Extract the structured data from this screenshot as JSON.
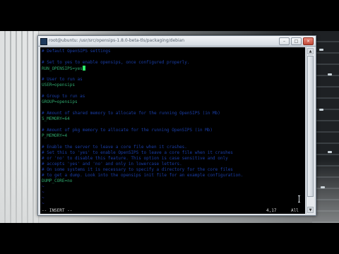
{
  "window": {
    "title": "root@ubuntu: /usr/src/opensips-1.8.0-beta-tls/packaging/debian",
    "minimize_glyph": "–",
    "maximize_glyph": "□",
    "close_glyph": "×"
  },
  "editor": {
    "lines": [
      {
        "text": "# Default OpenSIPS settings",
        "style": "comment"
      },
      {
        "text": "",
        "style": "setting"
      },
      {
        "text": "# Set to yes to enable opensips, once configured properly.",
        "style": "comment"
      },
      {
        "text": "RUN_OPENSIPS=yes",
        "style": "setting",
        "cursor": true
      },
      {
        "text": "",
        "style": "setting"
      },
      {
        "text": "# User to run as",
        "style": "comment"
      },
      {
        "text": "USER=opensips",
        "style": "setting"
      },
      {
        "text": "",
        "style": "setting"
      },
      {
        "text": "# Group to run as",
        "style": "comment"
      },
      {
        "text": "GROUP=opensips",
        "style": "setting"
      },
      {
        "text": "",
        "style": "setting"
      },
      {
        "text": "# Amount of shared memory to allocate for the running OpenSIPS (in Mb)",
        "style": "comment"
      },
      {
        "text": "S_MEMORY=64",
        "style": "setting"
      },
      {
        "text": "",
        "style": "setting"
      },
      {
        "text": "# Amount of pkg memory to allocate for the running OpenSIPS (in Mb)",
        "style": "comment"
      },
      {
        "text": "P_MEMORY=4",
        "style": "setting"
      },
      {
        "text": "",
        "style": "setting"
      },
      {
        "text": "# Enable the server to leave a core file when it crashes.",
        "style": "comment"
      },
      {
        "text": "# Set this to 'yes' to enable OpenSIPS to leave a core file when it crashes",
        "style": "comment"
      },
      {
        "text": "# or 'no' to disable this feature. This option is case sensitive and only",
        "style": "comment"
      },
      {
        "text": "# accepts 'yes' and 'no' and only in lowercase letters.",
        "style": "comment"
      },
      {
        "text": "# On some systems it is necessary to specify a directory for the core files",
        "style": "comment"
      },
      {
        "text": "# to get a dump. Look into the opensips init file for an example configuration.",
        "style": "comment"
      },
      {
        "text": "DUMP_CORE=no",
        "style": "setting"
      },
      {
        "text": "~",
        "style": "tilde"
      },
      {
        "text": "~",
        "style": "tilde"
      },
      {
        "text": "~",
        "style": "tilde"
      },
      {
        "text": "~",
        "style": "tilde"
      }
    ],
    "status_mode": "-- INSERT --",
    "status_position": "4,17",
    "status_percent": "All"
  },
  "colors": {
    "comment": "#1a3ea8",
    "setting": "#2ea66d",
    "tilde": "#2a3cc0",
    "cursor": "#2ef06a"
  }
}
